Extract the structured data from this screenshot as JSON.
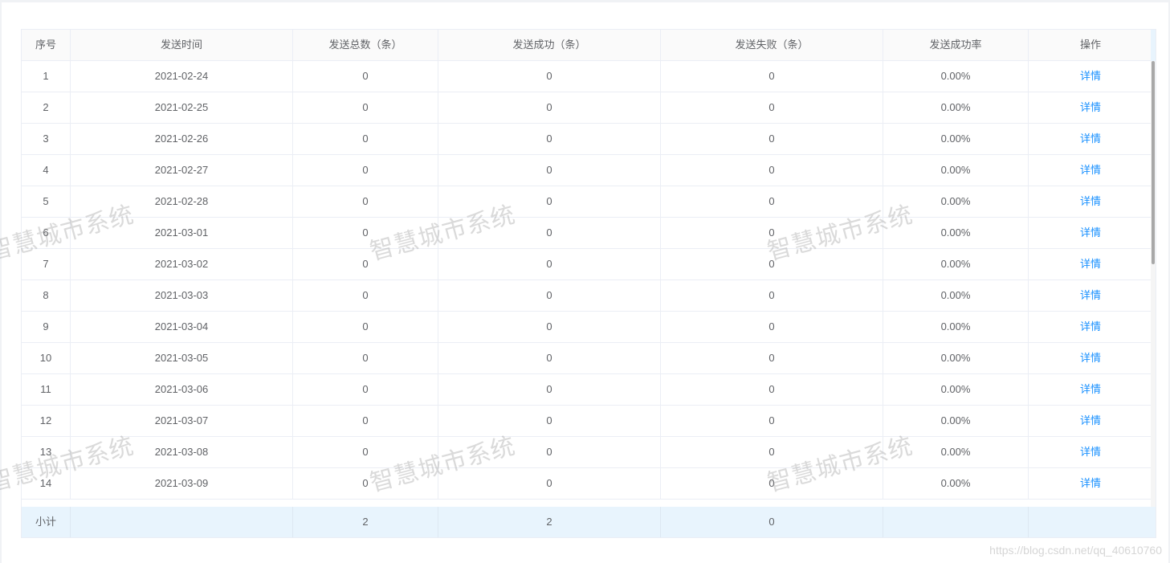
{
  "table": {
    "headers": [
      "序号",
      "发送时间",
      "发送总数（条）",
      "发送成功（条）",
      "发送失败（条）",
      "发送成功率",
      "操作"
    ],
    "rows": [
      {
        "index": "1",
        "date": "2021-02-24",
        "total": "0",
        "success": "0",
        "fail": "0",
        "rate": "0.00%",
        "action": "详情"
      },
      {
        "index": "2",
        "date": "2021-02-25",
        "total": "0",
        "success": "0",
        "fail": "0",
        "rate": "0.00%",
        "action": "详情"
      },
      {
        "index": "3",
        "date": "2021-02-26",
        "total": "0",
        "success": "0",
        "fail": "0",
        "rate": "0.00%",
        "action": "详情"
      },
      {
        "index": "4",
        "date": "2021-02-27",
        "total": "0",
        "success": "0",
        "fail": "0",
        "rate": "0.00%",
        "action": "详情"
      },
      {
        "index": "5",
        "date": "2021-02-28",
        "total": "0",
        "success": "0",
        "fail": "0",
        "rate": "0.00%",
        "action": "详情"
      },
      {
        "index": "6",
        "date": "2021-03-01",
        "total": "0",
        "success": "0",
        "fail": "0",
        "rate": "0.00%",
        "action": "详情"
      },
      {
        "index": "7",
        "date": "2021-03-02",
        "total": "0",
        "success": "0",
        "fail": "0",
        "rate": "0.00%",
        "action": "详情"
      },
      {
        "index": "8",
        "date": "2021-03-03",
        "total": "0",
        "success": "0",
        "fail": "0",
        "rate": "0.00%",
        "action": "详情"
      },
      {
        "index": "9",
        "date": "2021-03-04",
        "total": "0",
        "success": "0",
        "fail": "0",
        "rate": "0.00%",
        "action": "详情"
      },
      {
        "index": "10",
        "date": "2021-03-05",
        "total": "0",
        "success": "0",
        "fail": "0",
        "rate": "0.00%",
        "action": "详情"
      },
      {
        "index": "11",
        "date": "2021-03-06",
        "total": "0",
        "success": "0",
        "fail": "0",
        "rate": "0.00%",
        "action": "详情"
      },
      {
        "index": "12",
        "date": "2021-03-07",
        "total": "0",
        "success": "0",
        "fail": "0",
        "rate": "0.00%",
        "action": "详情"
      },
      {
        "index": "13",
        "date": "2021-03-08",
        "total": "0",
        "success": "0",
        "fail": "0",
        "rate": "0.00%",
        "action": "详情"
      },
      {
        "index": "14",
        "date": "2021-03-09",
        "total": "0",
        "success": "0",
        "fail": "0",
        "rate": "0.00%",
        "action": "详情"
      }
    ],
    "summary": {
      "label": "小计",
      "date": "",
      "total": "2",
      "success": "2",
      "fail": "0",
      "rate": "",
      "action": ""
    }
  },
  "watermark": "智慧城市系统",
  "credit": "https://blog.csdn.net/qq_40610760",
  "colors": {
    "link": "#1890ff",
    "header_bg": "#fafafa",
    "summary_bg": "#e8f4fd"
  }
}
